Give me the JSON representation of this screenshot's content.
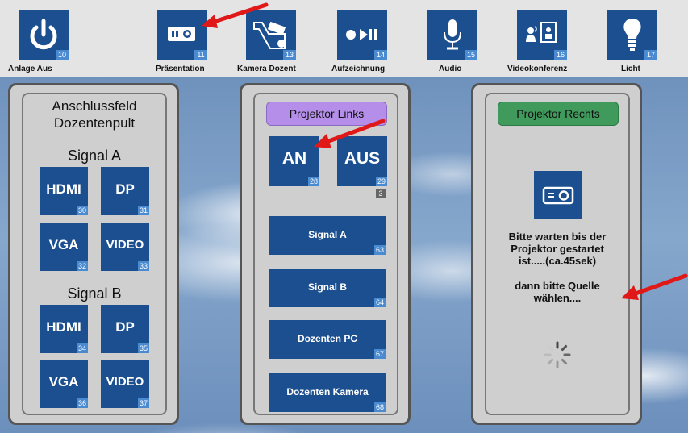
{
  "topbar": {
    "buttons": [
      {
        "label": "Anlage Aus",
        "num": "10",
        "icon": "power-icon"
      },
      {
        "label": "Präsentation",
        "num": "11",
        "icon": "projector-icon"
      },
      {
        "label": "Kamera Dozent",
        "num": "13",
        "icon": "camera-icon"
      },
      {
        "label": "Aufzeichnung",
        "num": "14",
        "icon": "record-play-pause-icon"
      },
      {
        "label": "Audio",
        "num": "15",
        "icon": "microphone-icon"
      },
      {
        "label": "Videokonferenz",
        "num": "16",
        "icon": "videoconference-icon"
      },
      {
        "label": "Licht",
        "num": "17",
        "icon": "lightbulb-icon"
      }
    ]
  },
  "left_panel": {
    "title_line1": "Anschlussfeld",
    "title_line2": "Dozentenpult",
    "signal_a": {
      "label": "Signal A",
      "buttons": [
        {
          "label": "HDMI",
          "num": "30"
        },
        {
          "label": "DP",
          "num": "31"
        },
        {
          "label": "VGA",
          "num": "32"
        },
        {
          "label": "VIDEO",
          "num": "33"
        }
      ]
    },
    "signal_b": {
      "label": "Signal B",
      "buttons": [
        {
          "label": "HDMI",
          "num": "34"
        },
        {
          "label": "DP",
          "num": "35"
        },
        {
          "label": "VGA",
          "num": "36"
        },
        {
          "label": "VIDEO",
          "num": "37"
        }
      ]
    }
  },
  "middle_panel": {
    "header": "Projektor Links",
    "on_button": {
      "label": "AN",
      "num": "28"
    },
    "off_button": {
      "label": "AUS",
      "num": "29"
    },
    "status_num": "3",
    "source_buttons": [
      {
        "label": "Signal A",
        "num": "63"
      },
      {
        "label": "Signal B",
        "num": "64"
      },
      {
        "label": "Dozenten PC",
        "num": "67"
      },
      {
        "label": "Dozenten Kamera",
        "num": "68"
      }
    ]
  },
  "right_panel": {
    "header": "Projektor Rechts",
    "message_line1": "Bitte warten bis der",
    "message_line2": "Projektor gestartet",
    "message_line3": "ist.....(ca.45sek)",
    "message_line4": "dann bitte Quelle",
    "message_line5": "wählen...."
  },
  "colors": {
    "button_blue": "#1c4f8f",
    "number_badge": "#4a8ad0",
    "header_purple": "#b48ee8",
    "header_green": "#3f9a5c",
    "annotation_red": "#e01818"
  }
}
